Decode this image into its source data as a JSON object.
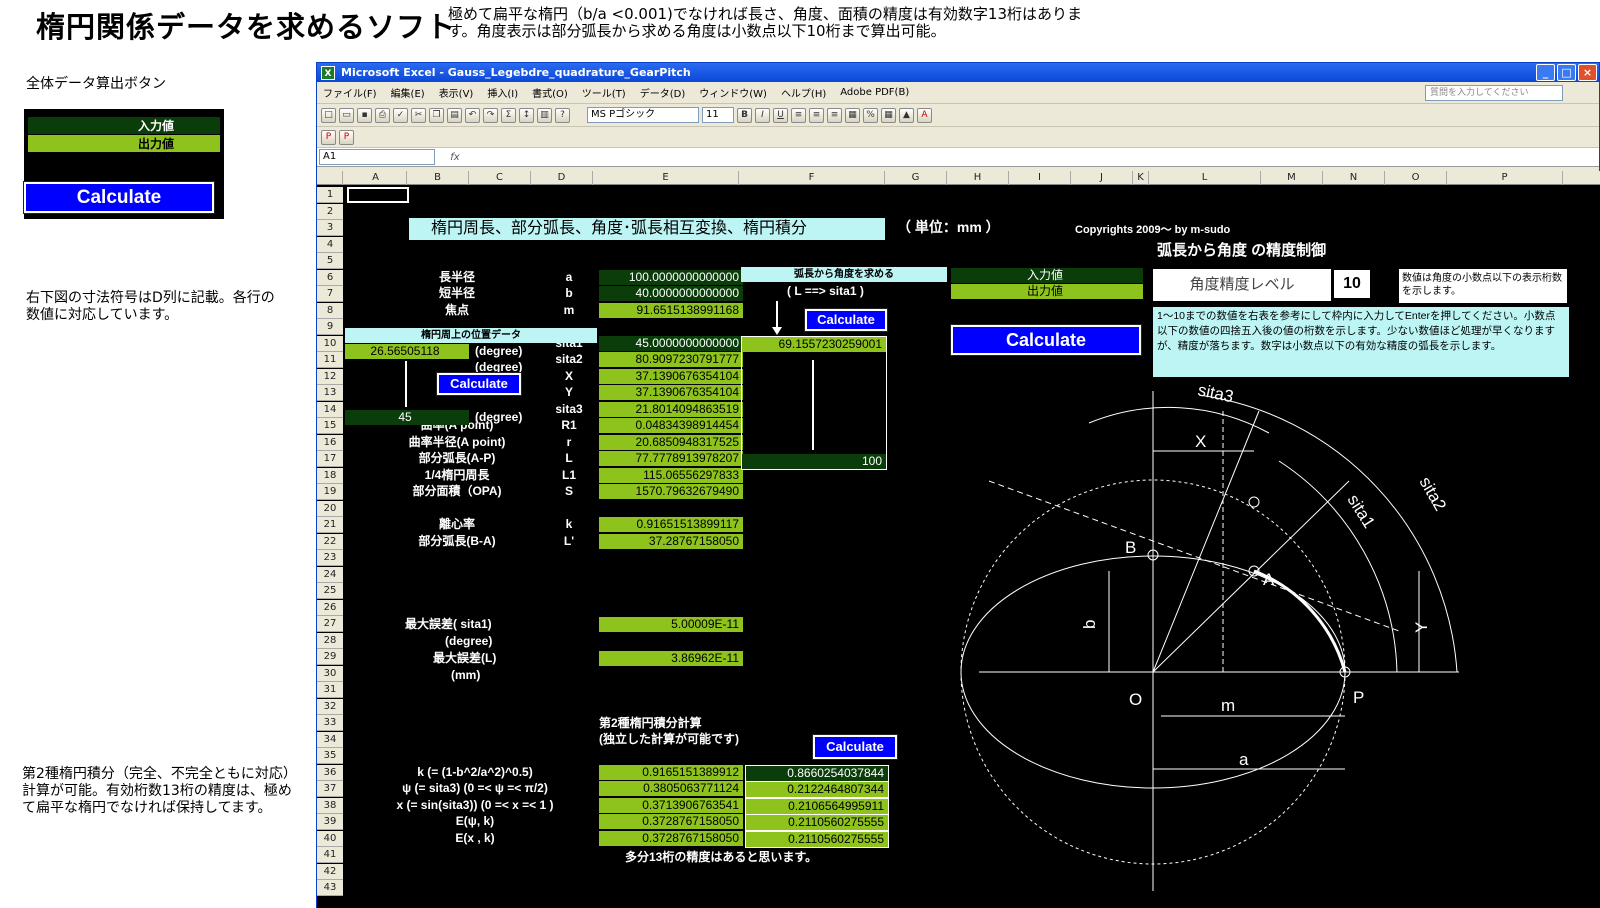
{
  "title": "楕円関係データを求めるソフト",
  "description": "極めて扁平な楕円（b/a <0.001)でなければ長さ、角度、面積の精度は有効数字13桁はあります。角度表示は部分弧長から求める角度は小数点以下10桁まで算出可能。",
  "left": {
    "calc_all_label": "全体データ算出ボタン",
    "legend_input": "入力値",
    "legend_output": "出力値",
    "calc_btn": "Calculate",
    "dim_note": "右下図の寸法符号はD列に記載。各行の数値に対応しています。",
    "integral_note": "第2種楕円積分（完全、不完全ともに対応）計算が可能。有効桁数13桁の精度は、極めて扁平な楕円でなければ保持してます。"
  },
  "window": {
    "title": "Microsoft Excel - Gauss_Legebdre_quadrature_GearPitch",
    "menu": [
      "ファイル(F)",
      "編集(E)",
      "表示(V)",
      "挿入(I)",
      "書式(O)",
      "ツール(T)",
      "データ(D)",
      "ウィンドウ(W)",
      "ヘルプ(H)",
      "Adobe PDF(B)"
    ],
    "help_placeholder": "質問を入力してください",
    "font": "MS Pゴシック",
    "font_size": "11",
    "cell_ref": "A1",
    "fx": "fx"
  },
  "columns": [
    "A",
    "B",
    "C",
    "D",
    "E",
    "F",
    "G",
    "H",
    "I",
    "J",
    "K",
    "L",
    "M",
    "N",
    "O",
    "P"
  ],
  "sheet": {
    "header": "楕円周長、部分弧長、角度･弧長相互変換、楕円積分",
    "unit": "（ 単位：mm ）",
    "copyright": "Copyrights 2009～ by m-sudo",
    "pos_header": "楕円周上の位置データ",
    "a10": "26.56505118",
    "a14": "45",
    "deg": "(degree)",
    "calc": "Calculate",
    "rows": [
      {
        "r": 6,
        "label": "長半径",
        "sym": "a",
        "val": "100.0000000000000",
        "t": "dg"
      },
      {
        "r": 7,
        "label": "短半径",
        "sym": "b",
        "val": "40.0000000000000",
        "t": "dg"
      },
      {
        "r": 8,
        "label": "焦点",
        "sym": "m",
        "val": "91.6515138991168",
        "t": "g"
      },
      {
        "r": 10,
        "label": "",
        "sym": "sita1",
        "val": "45.0000000000000",
        "t": "dg"
      },
      {
        "r": 11,
        "label": "",
        "sym": "sita2",
        "val": "80.9097230791777",
        "t": "g"
      },
      {
        "r": 12,
        "label": "",
        "sym": "X",
        "val": "37.1390676354104",
        "t": "g"
      },
      {
        "r": 13,
        "label": "",
        "sym": "Y",
        "val": "37.1390676354104",
        "t": "g"
      },
      {
        "r": 14,
        "label": "",
        "sym": "sita3",
        "val": "21.8014094863519",
        "t": "g"
      },
      {
        "r": 15,
        "label": "曲率(A point)",
        "sym": "R1",
        "val": "0.04834398914454",
        "t": "g"
      },
      {
        "r": 16,
        "label": "曲率半径(A point)",
        "sym": "r",
        "val": "20.6850948317525",
        "t": "g"
      },
      {
        "r": 17,
        "label": "部分弧長(A-P)",
        "sym": "L",
        "val": "77.7778913978207",
        "t": "g"
      },
      {
        "r": 18,
        "label": "1/4楕円周長",
        "sym": "L1",
        "val": "115.06556297833",
        "t": "g"
      },
      {
        "r": 19,
        "label": "部分面積（OPA)",
        "sym": "S",
        "val": "1570.79632679490",
        "t": "g"
      },
      {
        "r": 21,
        "label": "離心率",
        "sym": "k",
        "val": "0.91651513899117",
        "t": "g"
      },
      {
        "r": 22,
        "label": "部分弧長(B-A)",
        "sym": "L'",
        "val": "37.28767158050",
        "t": "g"
      }
    ],
    "err1_label": "最大誤差( sita1)",
    "err1_unit": "(degree)",
    "err1_val": "5.00009E-11",
    "err2_label": "最大誤差(L)",
    "err2_unit": "(mm)",
    "err2_val": "3.86962E-11",
    "conv": {
      "title": "弧長から角度を求める",
      "sub": "( L ==> sita1 )",
      "result": "69.1557230259001",
      "input": "100"
    },
    "precision": {
      "title": "弧長から角度 の精度制御",
      "label": "角度精度レベル",
      "level": "10",
      "note": "数値は角度の小数点以下の表示桁数を示します。",
      "desc": "1～10までの数値を右表を参考にして枠内に入力してEnterを押してください。小数点以下の数値の四捨五入後の値の桁数を示します。少ない数値ほど処理が早くなりますが、精度が落ちます。数字は小数点以下の有効な精度の弧長を示します。"
    },
    "integral": {
      "title1": "第2種楕円積分計算",
      "title2": "(独立した計算が可能です)",
      "footer": "多分13桁の精度はあると思います。",
      "rows": [
        {
          "label": "k (= (1-b^2/a^2)^0.5)",
          "v1": "0.9165151389912",
          "v2": "0.8660254037844"
        },
        {
          "label": "ψ (= sita3) (0 =< ψ =< π/2)",
          "v1": "0.3805063771124",
          "v2": "0.2122464807344"
        },
        {
          "label": "x (= sin(sita3)) (0 =< x =< 1 )",
          "v1": "0.3713906763541",
          "v2": "0.2106564995911"
        },
        {
          "label": "E(ψ, k)",
          "v1": "0.3728767158050",
          "v2": "0.2110560275555"
        },
        {
          "label": "E(x , k)",
          "v1": "0.3728767158050",
          "v2": "0.2110560275555"
        }
      ]
    },
    "diagram": {
      "sita1": "sita1",
      "sita2": "sita2",
      "sita3": "sita3",
      "X": "X",
      "Y": "Y",
      "A": "A",
      "B": "B",
      "O": "O",
      "P": "P",
      "b": "b",
      "m": "m",
      "a": "a"
    }
  }
}
